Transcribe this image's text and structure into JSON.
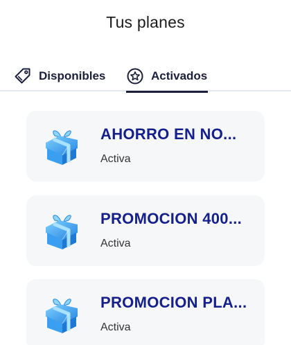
{
  "header": {
    "title": "Tus planes"
  },
  "tabs": [
    {
      "label": "Disponibles",
      "icon": "tag-icon",
      "active": false
    },
    {
      "label": "Activados",
      "icon": "star-circle-icon",
      "active": true
    }
  ],
  "plans": [
    {
      "name": "AHORRO EN NO...",
      "status": "Activa",
      "icon": "gift-icon"
    },
    {
      "name": "PROMOCION 400...",
      "status": "Activa",
      "icon": "gift-icon"
    },
    {
      "name": "PROMOCION PLA...",
      "status": "Activa",
      "icon": "gift-icon"
    }
  ],
  "colors": {
    "accent": "#15208a",
    "tab_text": "#1b1f3a",
    "card_bg": "#f6f7f8",
    "gift": "#3aa0ee"
  }
}
